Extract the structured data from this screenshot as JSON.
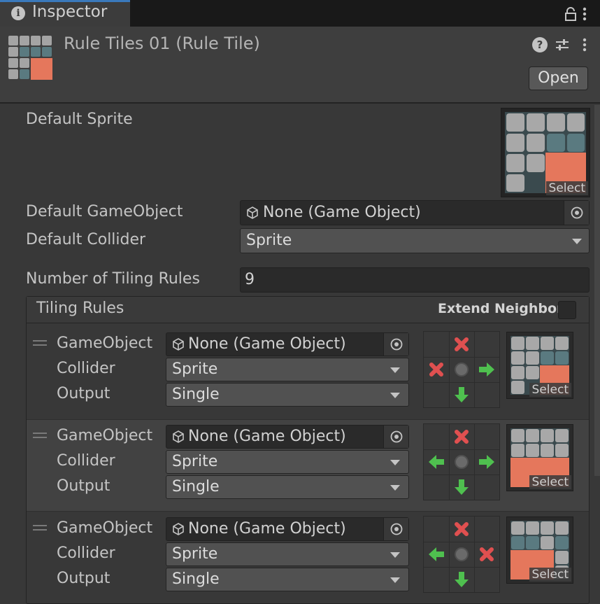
{
  "tab": {
    "title": "Inspector",
    "icon": "info-icon"
  },
  "header": {
    "title": "Rule Tiles 01 (Rule Tile)",
    "open_label": "Open"
  },
  "fields": {
    "default_sprite_label": "Default Sprite",
    "select_label": "Select",
    "default_gameobject_label": "Default GameObject",
    "default_gameobject_value": "None (Game Object)",
    "default_collider_label": "Default Collider",
    "default_collider_value": "Sprite",
    "num_rules_label": "Number of Tiling Rules",
    "num_rules_value": "9"
  },
  "tiling_rules": {
    "title": "Tiling Rules",
    "extend_neighbor_label": "Extend Neighbor",
    "extend_neighbor_checked": false,
    "rules": [
      {
        "gameobject_label": "GameObject",
        "gameobject_value": "None (Game Object)",
        "collider_label": "Collider",
        "collider_value": "Sprite",
        "output_label": "Output",
        "output_value": "Single",
        "select_label": "Select",
        "neighbors": [
          "",
          "x",
          "",
          "x",
          "center",
          "right",
          "",
          "down",
          ""
        ]
      },
      {
        "gameobject_label": "GameObject",
        "gameobject_value": "None (Game Object)",
        "collider_label": "Collider",
        "collider_value": "Sprite",
        "output_label": "Output",
        "output_value": "Single",
        "select_label": "Select",
        "neighbors": [
          "",
          "x",
          "",
          "left",
          "center",
          "right",
          "",
          "down",
          ""
        ]
      },
      {
        "gameobject_label": "GameObject",
        "gameobject_value": "None (Game Object)",
        "collider_label": "Collider",
        "collider_value": "Sprite",
        "output_label": "Output",
        "output_value": "Single",
        "select_label": "Select",
        "neighbors": [
          "",
          "x",
          "",
          "left",
          "center",
          "x",
          "",
          "down",
          ""
        ]
      }
    ]
  },
  "colors": {
    "accent": "#3a79bb",
    "arrow_green": "#4fc04f",
    "cross_red": "#e05050",
    "tile_gray": "#a8a8a8",
    "tile_teal": "#5a7a80",
    "tile_orange": "#e5775c"
  }
}
